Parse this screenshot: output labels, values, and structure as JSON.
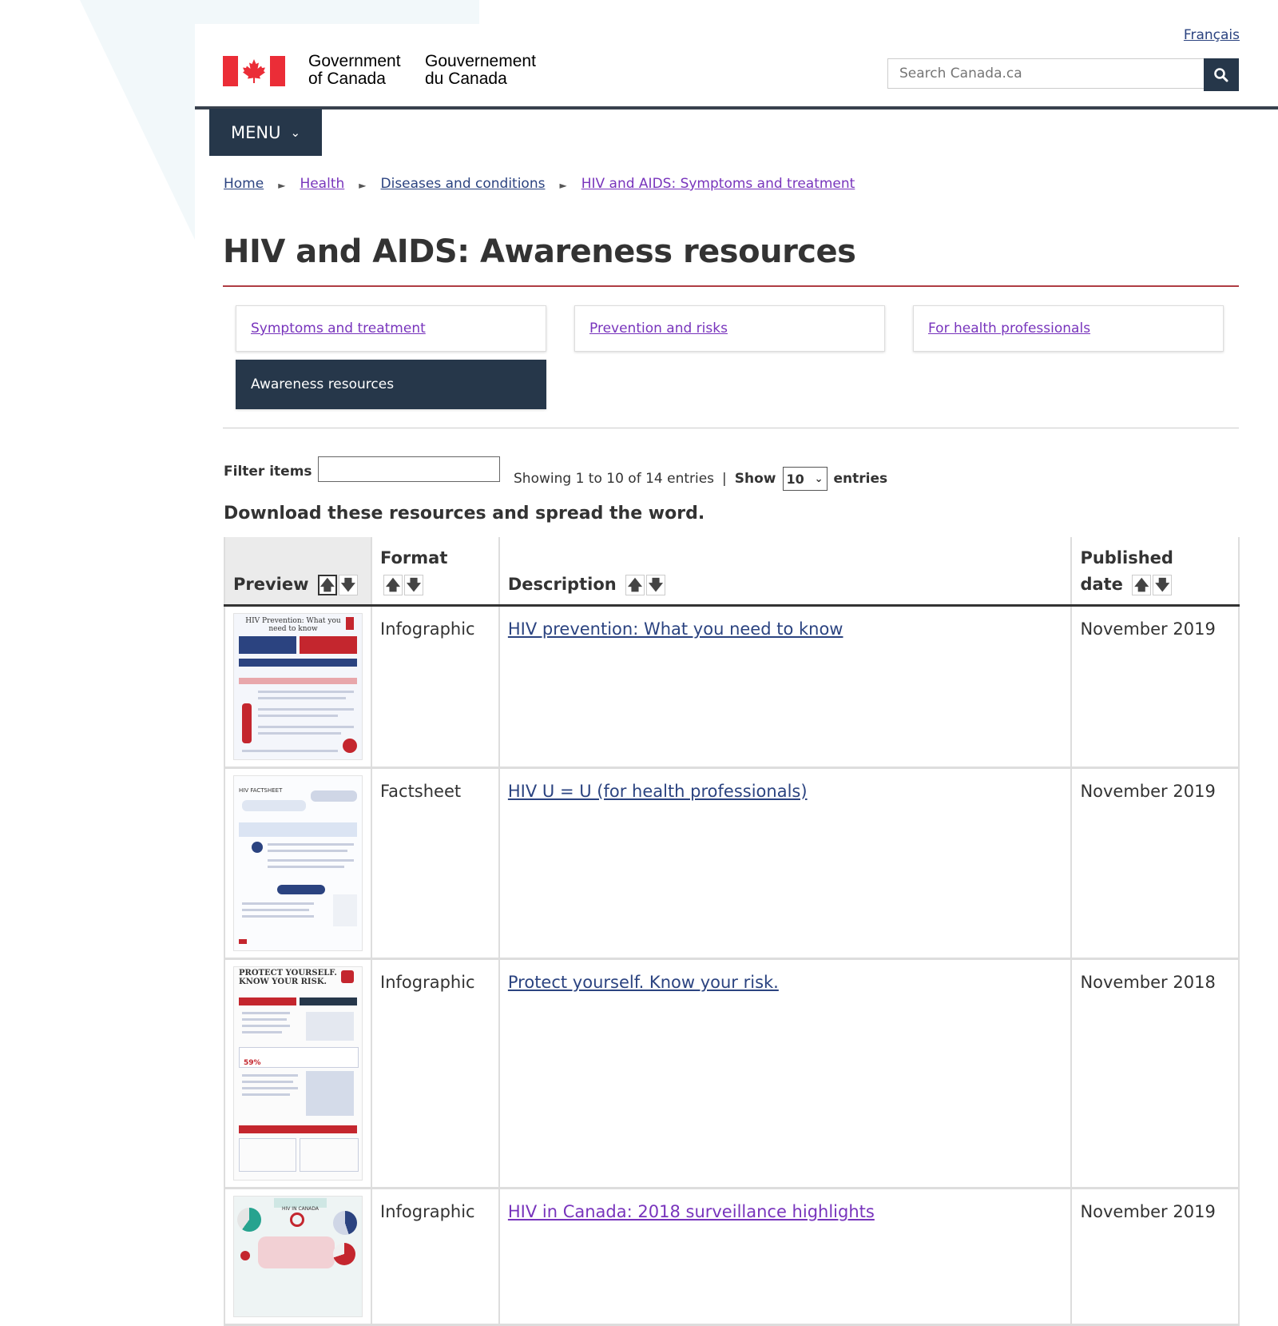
{
  "header": {
    "language_link": "Français",
    "sig_en_line1": "Government",
    "sig_en_line2": "of Canada",
    "sig_fr_line1": "Gouvernement",
    "sig_fr_line2": "du Canada",
    "search_placeholder": "Search Canada.ca",
    "menu_label": "MENU"
  },
  "breadcrumb": [
    "Home",
    "Health",
    "Diseases and conditions",
    "HIV and AIDS: Symptoms and treatment"
  ],
  "page_title": "HIV and AIDS: Awareness resources",
  "nav_tiles": [
    {
      "label": "Symptoms and treatment",
      "active": false
    },
    {
      "label": "Prevention and risks",
      "active": false
    },
    {
      "label": "For health professionals",
      "active": false
    },
    {
      "label": "Awareness resources",
      "active": true
    }
  ],
  "filter": {
    "label": "Filter items",
    "showing": "Showing 1 to 10 of 14 entries",
    "show_label": "Show",
    "show_value": "10",
    "entries_label": "entries"
  },
  "intro": "Download these resources and spread the word.",
  "table": {
    "headers": {
      "preview": "Preview",
      "format": "Format",
      "description": "Description",
      "published_line1": "Published",
      "published_line2": "date"
    },
    "rows": [
      {
        "format": "Infographic",
        "description": "HIV prevention: What you need to know",
        "date": "November 2019",
        "thumb_title": "HIV Prevention: What you need to know"
      },
      {
        "format": "Factsheet",
        "description": "HIV U = U (for health professionals)",
        "date": "November 2019",
        "thumb_title": "HIV FACTSHEET"
      },
      {
        "format": "Infographic",
        "description": "Protect yourself. Know your risk.",
        "date": "November 2018",
        "thumb_title": "PROTECT YOURSELF. KNOW YOUR RISK."
      },
      {
        "format": "Infographic",
        "description": "HIV in Canada: 2018 surveillance highlights",
        "date": "November 2019",
        "thumb_title": "HIV IN CANADA"
      }
    ]
  },
  "colors": {
    "brand_dark": "#26374a",
    "flag_red": "#eb2d37",
    "title_rule": "#af3c43",
    "link": "#2b4380",
    "visited_link": "#7834bc"
  }
}
